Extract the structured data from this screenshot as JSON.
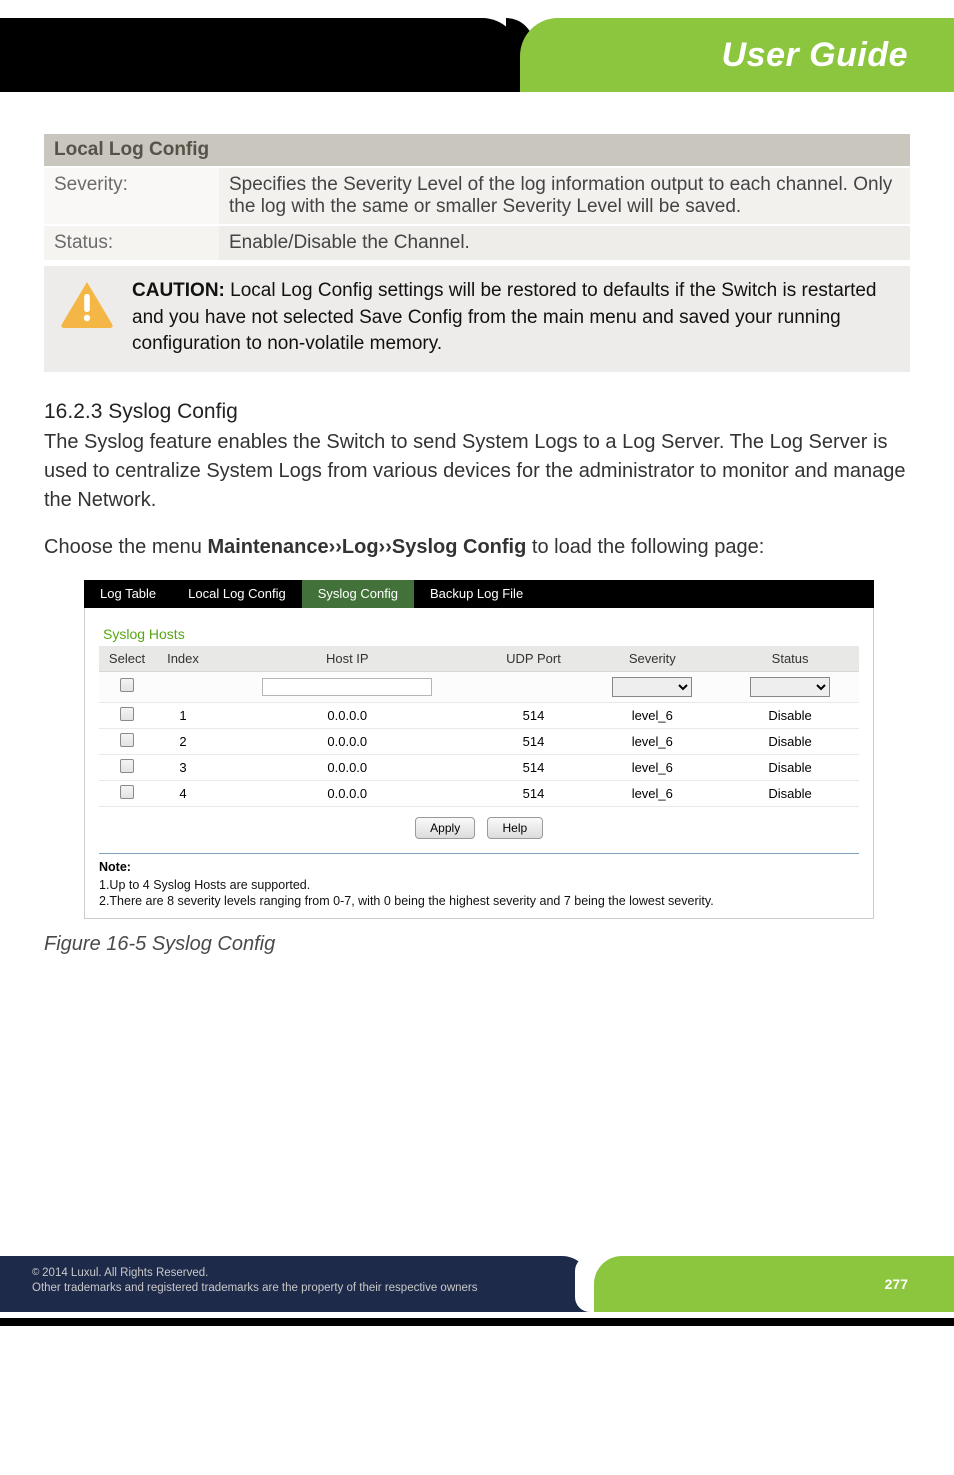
{
  "header": {
    "badge": "User Guide"
  },
  "local_log": {
    "title": "Local Log Config",
    "rows": [
      {
        "label": "Severity:",
        "value": "Specifies the Severity Level of the log information output to each channel. Only the log with the same or smaller Severity Level will be saved."
      },
      {
        "label": "Status:",
        "value": "Enable/Disable the Channel."
      }
    ]
  },
  "caution": {
    "lead": "CAUTION:",
    "text": " Local Log Config settings will be restored to defaults if the Switch is restarted and you have not selected Save Config from the main menu and saved your running configuration to non-volatile memory."
  },
  "section": {
    "heading": "16.2.3 Syslog Config",
    "p1": "The Syslog feature enables the Switch to send System Logs to a Log Server. The Log Server is used to centralize System Logs from various devices for the administrator to monitor and manage the Network.",
    "p2a": "Choose the menu ",
    "p2b": "Maintenance››Log››Syslog Config",
    "p2c": " to load the following page:"
  },
  "shot": {
    "tabs": [
      "Log Table",
      "Local Log Config",
      "Syslog Config",
      "Backup Log File"
    ],
    "active_tab_index": 2,
    "panel_title": "Syslog Hosts",
    "columns": [
      "Select",
      "Index",
      "Host IP",
      "UDP Port",
      "Severity",
      "Status"
    ],
    "rows": [
      {
        "index": "1",
        "host_ip": "0.0.0.0",
        "udp_port": "514",
        "severity": "level_6",
        "status": "Disable"
      },
      {
        "index": "2",
        "host_ip": "0.0.0.0",
        "udp_port": "514",
        "severity": "level_6",
        "status": "Disable"
      },
      {
        "index": "3",
        "host_ip": "0.0.0.0",
        "udp_port": "514",
        "severity": "level_6",
        "status": "Disable"
      },
      {
        "index": "4",
        "host_ip": "0.0.0.0",
        "udp_port": "514",
        "severity": "level_6",
        "status": "Disable"
      }
    ],
    "buttons": {
      "apply": "Apply",
      "help": "Help"
    },
    "note_label": "Note:",
    "note1": "1.Up to 4 Syslog Hosts are supported.",
    "note2": "2.There are 8 severity levels ranging from 0-7, with 0 being the highest severity and 7 being the lowest severity."
  },
  "figure_caption": "Figure 16-5 Syslog Config",
  "footer": {
    "line1a": "© ",
    "line1b": "2014  Luxul. All Rights Reserved.",
    "line2": "Other trademarks and registered trademarks are the property of their respective owners",
    "page": "277"
  },
  "chart_data": {
    "type": "table",
    "title": "Syslog Hosts",
    "columns": [
      "Index",
      "Host IP",
      "UDP Port",
      "Severity",
      "Status"
    ],
    "rows": [
      [
        1,
        "0.0.0.0",
        514,
        "level_6",
        "Disable"
      ],
      [
        2,
        "0.0.0.0",
        514,
        "level_6",
        "Disable"
      ],
      [
        3,
        "0.0.0.0",
        514,
        "level_6",
        "Disable"
      ],
      [
        4,
        "0.0.0.0",
        514,
        "level_6",
        "Disable"
      ]
    ]
  }
}
